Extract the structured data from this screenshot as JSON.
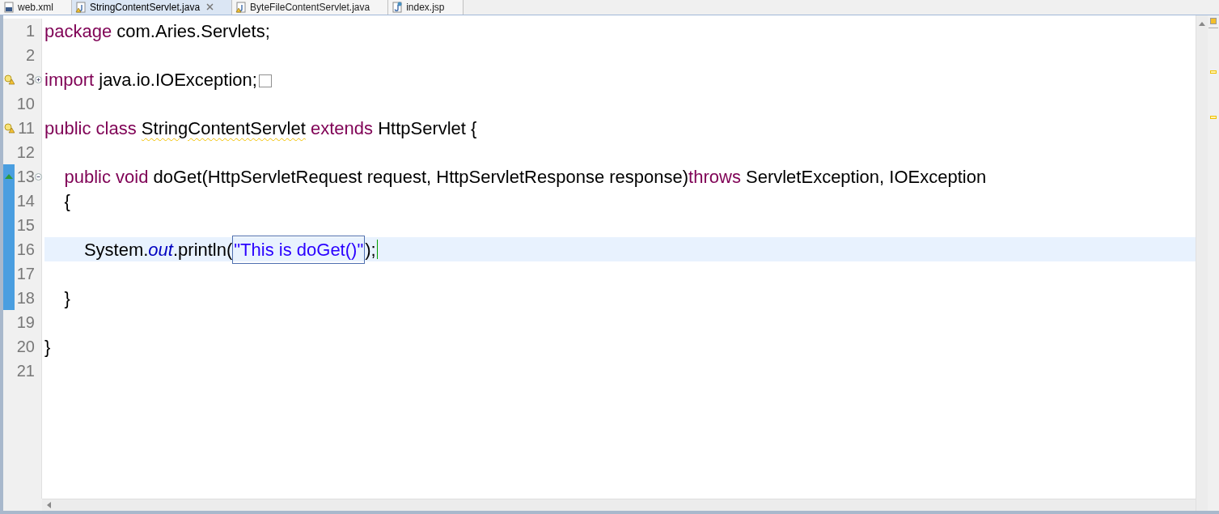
{
  "tabs": [
    {
      "label": "web.xml",
      "selected": false,
      "kind": "xml",
      "warning": false,
      "closable": false
    },
    {
      "label": "StringContentServlet.java",
      "selected": true,
      "kind": "java",
      "warning": true,
      "closable": true
    },
    {
      "label": "ByteFileContentServlet.java",
      "selected": false,
      "kind": "java",
      "warning": true,
      "closable": false
    },
    {
      "label": "index.jsp",
      "selected": false,
      "kind": "jsp",
      "warning": false,
      "closable": false
    }
  ],
  "lines": [
    {
      "number": "1",
      "changed": false,
      "current": false,
      "tokens": [
        {
          "text": "package",
          "kind": "keyword"
        },
        {
          "text": " com.Aries.Servlets;",
          "kind": "plain"
        }
      ]
    },
    {
      "number": "2",
      "changed": false,
      "current": false
    },
    {
      "number": "3",
      "warning": true,
      "expanded": false,
      "changed": false,
      "current": false,
      "folded": true,
      "tokens": [
        {
          "text": "import",
          "kind": "keyword"
        },
        {
          "text": " java.io.IOException;",
          "kind": "plain"
        }
      ]
    },
    {
      "number": "10",
      "changed": false,
      "current": false
    },
    {
      "number": "11",
      "warning": true,
      "changed": false,
      "current": false,
      "tokens": [
        {
          "text": "public class ",
          "kind": "keyword"
        },
        {
          "text": "StringContentServlet",
          "kind": "warned"
        },
        {
          "text": " extends",
          "kind": "keyword"
        },
        {
          "text": " HttpServlet {",
          "kind": "plain"
        }
      ]
    },
    {
      "number": "12",
      "changed": false,
      "current": false
    },
    {
      "number": "13",
      "override": true,
      "expanded": true,
      "changed": true,
      "current": false,
      "tokens": [
        {
          "text": "    public void",
          "kind": "keyword"
        },
        {
          "text": " doGet(HttpServletRequest request, HttpServletResponse response)",
          "kind": "plain"
        },
        {
          "text": "throws",
          "kind": "keyword"
        },
        {
          "text": " ServletException, IOException",
          "kind": "plain"
        }
      ]
    },
    {
      "number": "14",
      "changed": true,
      "current": false,
      "tokens": [
        {
          "text": "    {",
          "kind": "plain"
        }
      ]
    },
    {
      "number": "15",
      "changed": true,
      "current": false
    },
    {
      "number": "16",
      "changed": true,
      "current": true,
      "tokens": [
        {
          "text": "        System.",
          "kind": "plain"
        },
        {
          "text": "out",
          "kind": "field"
        },
        {
          "text": ".println(",
          "kind": "plain"
        },
        {
          "text": "\"This is doGet()\"",
          "kind": "linked-string"
        },
        {
          "text": ");",
          "kind": "plain"
        }
      ]
    },
    {
      "number": "17",
      "changed": true,
      "current": false
    },
    {
      "number": "18",
      "changed": true,
      "current": false,
      "tokens": [
        {
          "text": "    }",
          "kind": "plain"
        }
      ]
    },
    {
      "number": "19",
      "changed": false,
      "current": false
    },
    {
      "number": "20",
      "changed": false,
      "current": false,
      "tokens": [
        {
          "text": "}",
          "kind": "plain"
        }
      ]
    },
    {
      "number": "21",
      "changed": false,
      "current": false
    }
  ]
}
